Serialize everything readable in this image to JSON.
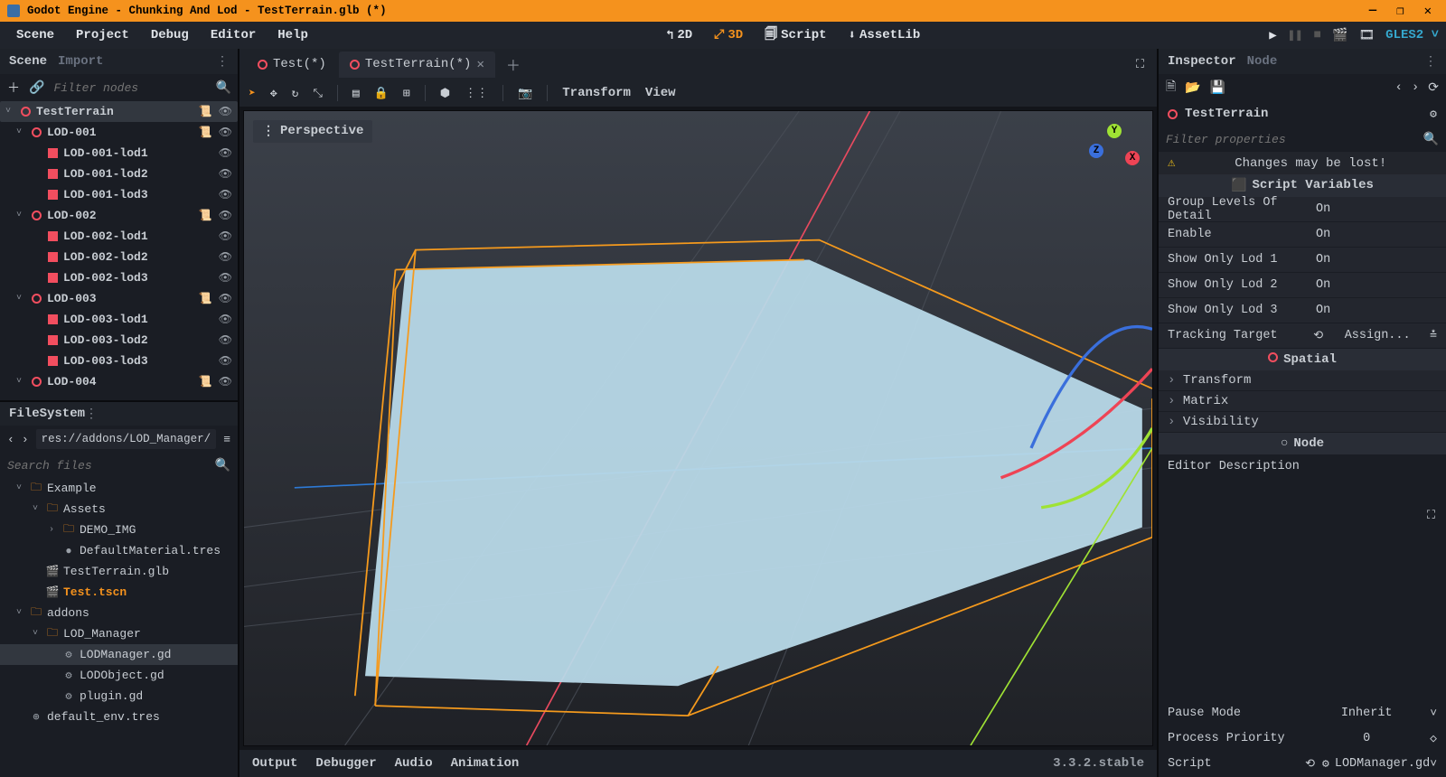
{
  "titlebar": {
    "text": "Godot Engine - Chunking And Lod - TestTerrain.glb (*)"
  },
  "menubar": {
    "items": [
      "Scene",
      "Project",
      "Debug",
      "Editor",
      "Help"
    ],
    "modes": {
      "d2": "2D",
      "d3": "3D",
      "script": "Script",
      "assetlib": "AssetLib"
    },
    "gles": "GLES2"
  },
  "scene_dock": {
    "tabs": {
      "scene": "Scene",
      "import": "Import"
    },
    "filter_placeholder": "Filter nodes",
    "nodes": [
      {
        "name": "TestTerrain",
        "type": "spatial",
        "depth": 0,
        "selected": true,
        "icons": [
          "script",
          "eye"
        ]
      },
      {
        "name": "LOD-001",
        "type": "spatial",
        "depth": 1,
        "icons": [
          "script",
          "eye"
        ]
      },
      {
        "name": "LOD-001-lod1",
        "type": "mesh",
        "depth": 2,
        "icons": [
          "eye"
        ]
      },
      {
        "name": "LOD-001-lod2",
        "type": "mesh",
        "depth": 2,
        "icons": [
          "eye"
        ]
      },
      {
        "name": "LOD-001-lod3",
        "type": "mesh",
        "depth": 2,
        "icons": [
          "eye"
        ]
      },
      {
        "name": "LOD-002",
        "type": "spatial",
        "depth": 1,
        "icons": [
          "script",
          "eye"
        ]
      },
      {
        "name": "LOD-002-lod1",
        "type": "mesh",
        "depth": 2,
        "icons": [
          "eye"
        ]
      },
      {
        "name": "LOD-002-lod2",
        "type": "mesh",
        "depth": 2,
        "icons": [
          "eye"
        ]
      },
      {
        "name": "LOD-002-lod3",
        "type": "mesh",
        "depth": 2,
        "icons": [
          "eye"
        ]
      },
      {
        "name": "LOD-003",
        "type": "spatial",
        "depth": 1,
        "icons": [
          "script",
          "eye"
        ]
      },
      {
        "name": "LOD-003-lod1",
        "type": "mesh",
        "depth": 2,
        "icons": [
          "eye"
        ]
      },
      {
        "name": "LOD-003-lod2",
        "type": "mesh",
        "depth": 2,
        "icons": [
          "eye"
        ]
      },
      {
        "name": "LOD-003-lod3",
        "type": "mesh",
        "depth": 2,
        "icons": [
          "eye"
        ]
      },
      {
        "name": "LOD-004",
        "type": "spatial",
        "depth": 1,
        "icons": [
          "script",
          "eye"
        ]
      }
    ]
  },
  "filesystem": {
    "title": "FileSystem",
    "path": "res://addons/LOD_Manager/",
    "search_placeholder": "Search files",
    "items": [
      {
        "name": "Example",
        "type": "folder",
        "depth": 0,
        "exp": true
      },
      {
        "name": "Assets",
        "type": "folder",
        "depth": 1,
        "exp": true
      },
      {
        "name": "DEMO_IMG",
        "type": "folder",
        "depth": 2,
        "exp": false,
        "closed": true
      },
      {
        "name": "DefaultMaterial.tres",
        "type": "material",
        "depth": 2
      },
      {
        "name": "TestTerrain.glb",
        "type": "scene",
        "depth": 1
      },
      {
        "name": "Test.tscn",
        "type": "scene",
        "depth": 1,
        "highlight": true
      },
      {
        "name": "addons",
        "type": "folder",
        "depth": 0,
        "exp": true
      },
      {
        "name": "LOD_Manager",
        "type": "folder",
        "depth": 1,
        "exp": true
      },
      {
        "name": "LODManager.gd",
        "type": "script",
        "depth": 2,
        "selected": true
      },
      {
        "name": "LODObject.gd",
        "type": "script",
        "depth": 2
      },
      {
        "name": "plugin.gd",
        "type": "script",
        "depth": 2
      },
      {
        "name": "default_env.tres",
        "type": "env",
        "depth": 0
      }
    ]
  },
  "viewport": {
    "tabs": [
      {
        "label": "Test(*)",
        "active": false
      },
      {
        "label": "TestTerrain(*)",
        "active": true
      }
    ],
    "perspective": "Perspective",
    "transform_label": "Transform",
    "view_label": "View",
    "gizmo": {
      "x": "X",
      "y": "Y",
      "z": "Z"
    }
  },
  "bottom": {
    "panels": [
      "Output",
      "Debugger",
      "Audio",
      "Animation"
    ],
    "version": "3.3.2.stable"
  },
  "inspector": {
    "tabs": {
      "inspector": "Inspector",
      "node": "Node"
    },
    "node_name": "TestTerrain",
    "filter_placeholder": "Filter properties",
    "warning": "Changes may be lost!",
    "script_vars_header": "Script Variables",
    "props": [
      {
        "label": "Group Levels Of Detail",
        "value": "On"
      },
      {
        "label": "Enable",
        "value": "On"
      },
      {
        "label": "Show Only Lod 1",
        "value": "On"
      },
      {
        "label": "Show Only Lod 2",
        "value": "On"
      },
      {
        "label": "Show Only Lod 3",
        "value": "On"
      }
    ],
    "tracking_target": {
      "label": "Tracking Target",
      "value": "Assign..."
    },
    "spatial_header": "Spatial",
    "spatial_sections": [
      "Transform",
      "Matrix",
      "Visibility"
    ],
    "node_header": "Node",
    "editor_desc": "Editor Description",
    "pause_mode": {
      "label": "Pause Mode",
      "value": "Inherit"
    },
    "process_priority": {
      "label": "Process Priority",
      "value": "0"
    },
    "script": {
      "label": "Script",
      "value": "LODManager.gd"
    }
  }
}
